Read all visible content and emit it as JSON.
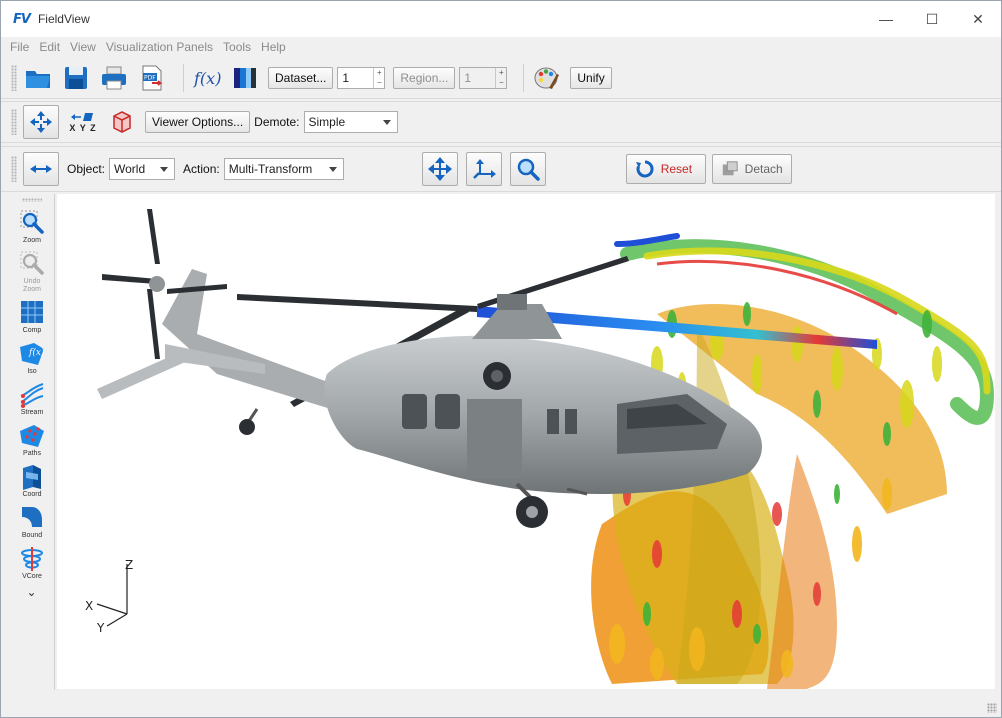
{
  "app": {
    "logo": "FV",
    "title": "FieldView"
  },
  "window_controls": {
    "minimize": "—",
    "maximize": "☐",
    "close": "✕"
  },
  "menu": [
    "File",
    "Edit",
    "View",
    "Visualization Panels",
    "Tools",
    "Help"
  ],
  "toolbar1": {
    "icons": [
      "open-folder-icon",
      "save-icon",
      "print-icon",
      "pdf-export-icon",
      "function-icon",
      "colormap-icon"
    ],
    "function_glyph": "f(x)",
    "pdf_glyph": "PDF",
    "dataset_button": "Dataset...",
    "dataset_value": "1",
    "region_button": "Region...",
    "region_value": "1",
    "unify_button": "Unify"
  },
  "toolbar2": {
    "xyz_label": "X Y Z",
    "viewer_options_button": "Viewer Options...",
    "demote_label": "Demote:",
    "demote_value": "Simple"
  },
  "toolbar3": {
    "object_label": "Object:",
    "object_value": "World",
    "action_label": "Action:",
    "action_value": "Multi-Transform",
    "reset_button": "Reset",
    "detach_button": "Detach"
  },
  "side_panel": {
    "items": [
      {
        "label": "Zoom",
        "icon": "zoom-icon",
        "enabled": true
      },
      {
        "label": "Undo Zoom",
        "icon": "undo-zoom-icon",
        "enabled": false
      },
      {
        "label": "Comp",
        "icon": "computational-surface-icon",
        "enabled": true
      },
      {
        "label": "Iso",
        "icon": "iso-surface-icon",
        "enabled": true
      },
      {
        "label": "Stream",
        "icon": "streamline-icon",
        "enabled": true
      },
      {
        "label": "Paths",
        "icon": "paths-icon",
        "enabled": true
      },
      {
        "label": "Coord",
        "icon": "coordinate-surface-icon",
        "enabled": true
      },
      {
        "label": "Bound",
        "icon": "boundary-surface-icon",
        "enabled": true
      },
      {
        "label": "VCore",
        "icon": "vortex-core-icon",
        "enabled": true
      }
    ],
    "more": "⌄"
  },
  "viewport": {
    "axes": {
      "x": "X",
      "y": "Y",
      "z": "Z"
    },
    "colors": {
      "fuselage": "#9ea3a6",
      "rotor": "#2b2f33",
      "wake_red": "#e53935",
      "wake_orange": "#ef8f12",
      "wake_yellow": "#d8d81a",
      "wake_green": "#3fb33a",
      "wake_blue": "#1f4fd6"
    }
  }
}
